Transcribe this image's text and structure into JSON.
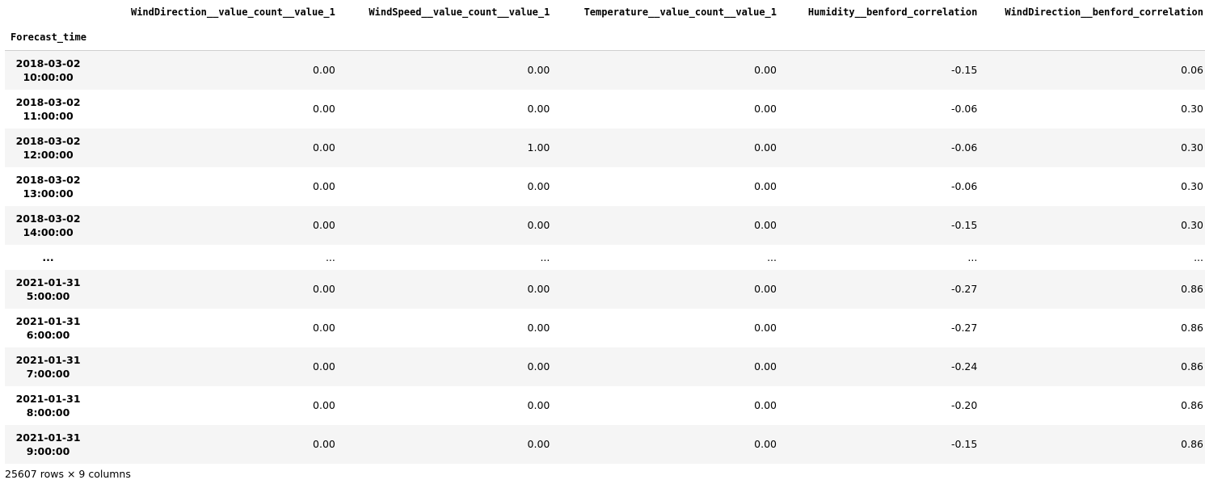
{
  "table": {
    "index_name": "Forecast_time",
    "columns": [
      "WindDirection__value_count__value_1",
      "WindSpeed__value_count__value_1",
      "Temperature__value_count__value_1",
      "Humidity__benford_correlation",
      "WindDirection__benford_correlation"
    ],
    "rows": [
      {
        "date": "2018-03-02",
        "time": "10:00:00",
        "values": [
          "0.00",
          "0.00",
          "0.00",
          "-0.15",
          "0.06"
        ]
      },
      {
        "date": "2018-03-02",
        "time": "11:00:00",
        "values": [
          "0.00",
          "0.00",
          "0.00",
          "-0.06",
          "0.30"
        ]
      },
      {
        "date": "2018-03-02",
        "time": "12:00:00",
        "values": [
          "0.00",
          "1.00",
          "0.00",
          "-0.06",
          "0.30"
        ]
      },
      {
        "date": "2018-03-02",
        "time": "13:00:00",
        "values": [
          "0.00",
          "0.00",
          "0.00",
          "-0.06",
          "0.30"
        ]
      },
      {
        "date": "2018-03-02",
        "time": "14:00:00",
        "values": [
          "0.00",
          "0.00",
          "0.00",
          "-0.15",
          "0.30"
        ]
      }
    ],
    "ellipsis": {
      "index": "...",
      "values": [
        "...",
        "...",
        "...",
        "...",
        "..."
      ]
    },
    "rows_tail": [
      {
        "date": "2021-01-31",
        "time": "5:00:00",
        "values": [
          "0.00",
          "0.00",
          "0.00",
          "-0.27",
          "0.86"
        ]
      },
      {
        "date": "2021-01-31",
        "time": "6:00:00",
        "values": [
          "0.00",
          "0.00",
          "0.00",
          "-0.27",
          "0.86"
        ]
      },
      {
        "date": "2021-01-31",
        "time": "7:00:00",
        "values": [
          "0.00",
          "0.00",
          "0.00",
          "-0.24",
          "0.86"
        ]
      },
      {
        "date": "2021-01-31",
        "time": "8:00:00",
        "values": [
          "0.00",
          "0.00",
          "0.00",
          "-0.20",
          "0.86"
        ]
      },
      {
        "date": "2021-01-31",
        "time": "9:00:00",
        "values": [
          "0.00",
          "0.00",
          "0.00",
          "-0.15",
          "0.86"
        ]
      }
    ]
  },
  "footer": "25607 rows × 9 columns"
}
